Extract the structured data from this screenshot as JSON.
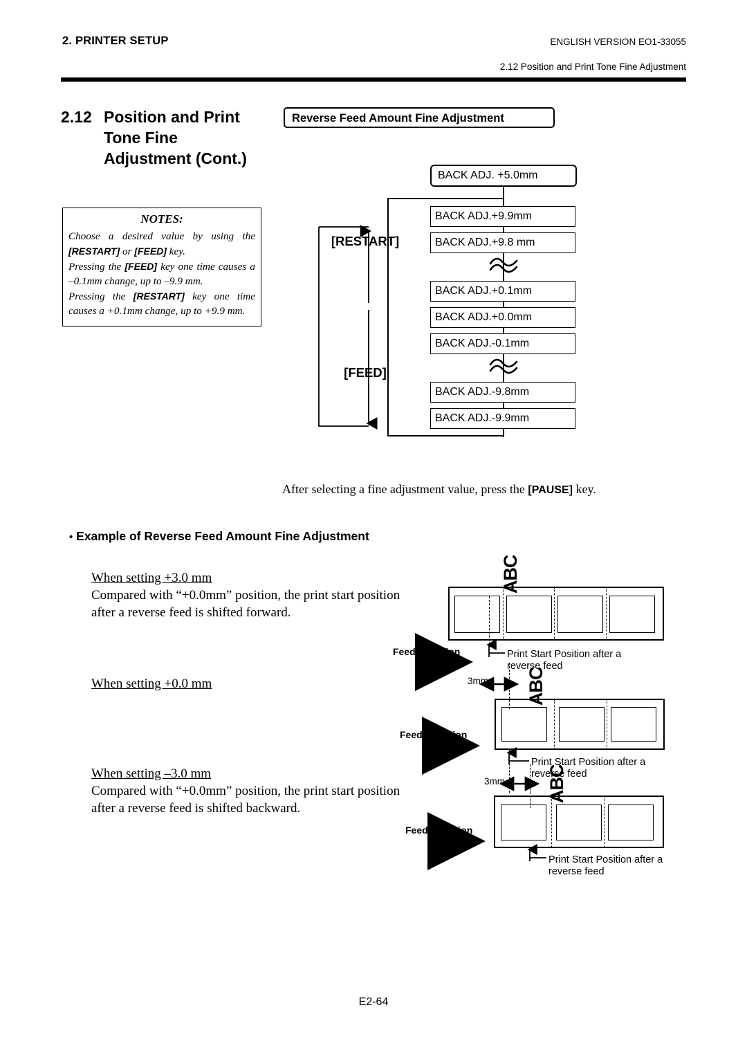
{
  "header": {
    "chapter": "2. PRINTER SETUP",
    "version": "ENGLISH VERSION EO1-33055",
    "section_ref": "2.12 Position and Print Tone Fine Adjustment"
  },
  "section": {
    "number": "2.12",
    "title_line1": "Position and Print",
    "title_line2": "Tone Fine",
    "title_line3": "Adjustment (Cont.)"
  },
  "notes": {
    "title": "NOTES:",
    "para1_a": "Choose a desired value by using the ",
    "para1_key1": "[RESTART]",
    "para1_b": " or ",
    "para1_key2": "[FEED]",
    "para1_c": " key.",
    "para2_a": "Pressing the ",
    "para2_key": "[FEED]",
    "para2_b": " key one time causes a –0.1mm change, up to –9.9 mm.",
    "para3_a": "Pressing the ",
    "para3_key": "[RESTART]",
    "para3_b": " key one time causes a +0.1mm change, up to +9.9 mm."
  },
  "flow": {
    "title": "Reverse Feed Amount Fine Adjustment",
    "top_box": "BACK ADJ. +5.0mm",
    "key_up": "[RESTART]",
    "key_down": "[FEED]",
    "items": [
      "BACK ADJ.+9.9mm",
      "BACK ADJ.+9.8 mm",
      "BACK ADJ.+0.1mm",
      "BACK ADJ.+0.0mm",
      "BACK ADJ.-0.1mm",
      "BACK ADJ.-9.8mm",
      "BACK ADJ.-9.9mm"
    ]
  },
  "pause_sentence": {
    "before": "After selecting a fine adjustment value, press the ",
    "key": "[PAUSE]",
    "after": " key."
  },
  "example_heading": {
    "bullet": "•",
    "text": "Example of Reverse Feed Amount Fine Adjustment"
  },
  "examples": [
    {
      "title": "When setting +3.0 mm",
      "desc_line1": "Compared with “+0.0mm” position, the print start position",
      "desc_line2": "after a reverse feed is shifted forward."
    },
    {
      "title": "When setting +0.0 mm",
      "desc_line1": "",
      "desc_line2": ""
    },
    {
      "title": "When setting –3.0 mm",
      "desc_line1": "Compared with “+0.0mm” position, the print start position",
      "desc_line2": "after a reverse feed is shifted backward."
    }
  ],
  "diagrams": {
    "feed_direction": "Feed Direction",
    "print_start_line1": "Print Start Position after a",
    "print_start_line2": "reverse feed",
    "gap_measure": "3mm",
    "label_text": "ABC"
  },
  "footer": {
    "page": "E2-64"
  },
  "colors": {
    "ink": "#000000",
    "paper": "#ffffff"
  }
}
